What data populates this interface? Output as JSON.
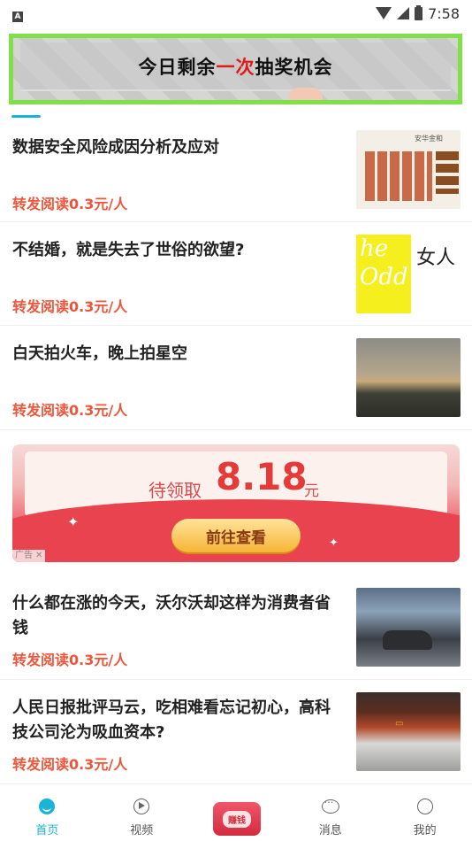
{
  "status_bar": {
    "time": "7:58",
    "notification_icon": "A"
  },
  "banner": {
    "text_before": "今日剩余",
    "text_highlight": "一次",
    "text_after": "抽奖机会"
  },
  "articles": [
    {
      "title": "数据安全风险成因分析及应对",
      "reward": "转发阅读0.3元/人",
      "thumb_header": "安华金和"
    },
    {
      "title": "不结婚，就是失去了世俗的欲望?",
      "reward": "转发阅读0.3元/人",
      "thumb_left_text": "he Odd",
      "thumb_right_text": "女人"
    },
    {
      "title": "白天拍火车，晚上拍星空",
      "reward": "转发阅读0.3元/人"
    },
    {
      "title": "什么都在涨的今天，沃尔沃却这样为消费者省钱",
      "reward": "转发阅读0.3元/人"
    },
    {
      "title": "人民日报批评马云，吃相难看忘记初心，高科技公司沦为吸血资本?",
      "reward": "转发阅读0.3元/人"
    }
  ],
  "ad": {
    "label": "待领取",
    "amount": "8.18",
    "unit": "元",
    "button": "前往查看",
    "badge": "广告",
    "badge_close": "✕"
  },
  "bottom_nav": {
    "home": "首页",
    "video": "视频",
    "earn": "赚钱",
    "messages": "消息",
    "me": "我的"
  },
  "colors": {
    "accent": "#19b4d8",
    "reward": "#f0553a",
    "banner_border": "#7fe04a"
  }
}
